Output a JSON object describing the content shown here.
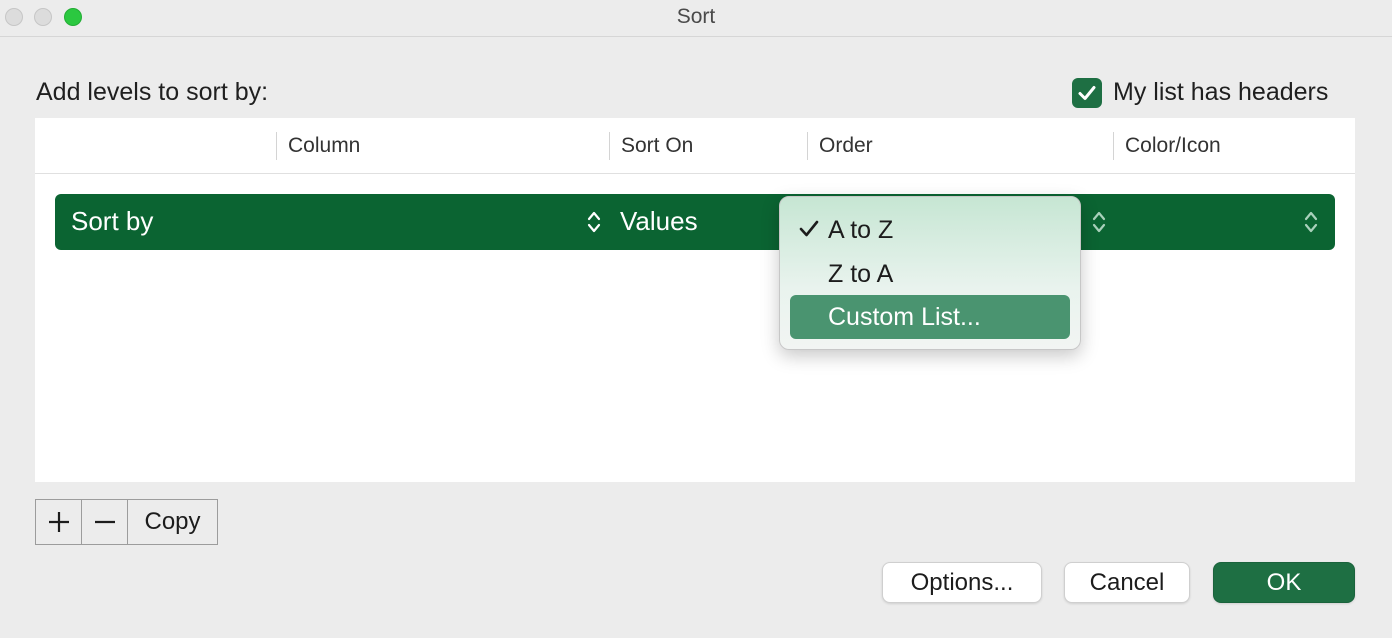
{
  "window": {
    "title": "Sort"
  },
  "dialog": {
    "levels_label": "Add levels to sort by:",
    "headers_checkbox": {
      "label": "My list has headers",
      "checked": true
    }
  },
  "table": {
    "headers": [
      "Column",
      "Sort On",
      "Order",
      "Color/Icon"
    ],
    "row": {
      "label": "Sort by",
      "sort_on": "Values"
    }
  },
  "order_dropdown": {
    "items": [
      {
        "label": "A to Z",
        "checked": true
      },
      {
        "label": "Z to A",
        "checked": false
      },
      {
        "label": "Custom List...",
        "checked": false,
        "highlighted": true
      }
    ]
  },
  "level_buttons": {
    "copy": "Copy"
  },
  "footer": {
    "options": "Options...",
    "cancel": "Cancel",
    "ok": "OK"
  },
  "colors": {
    "accent": "#1e6f43",
    "row": "#0b6432",
    "highlight": "#4a9470"
  }
}
